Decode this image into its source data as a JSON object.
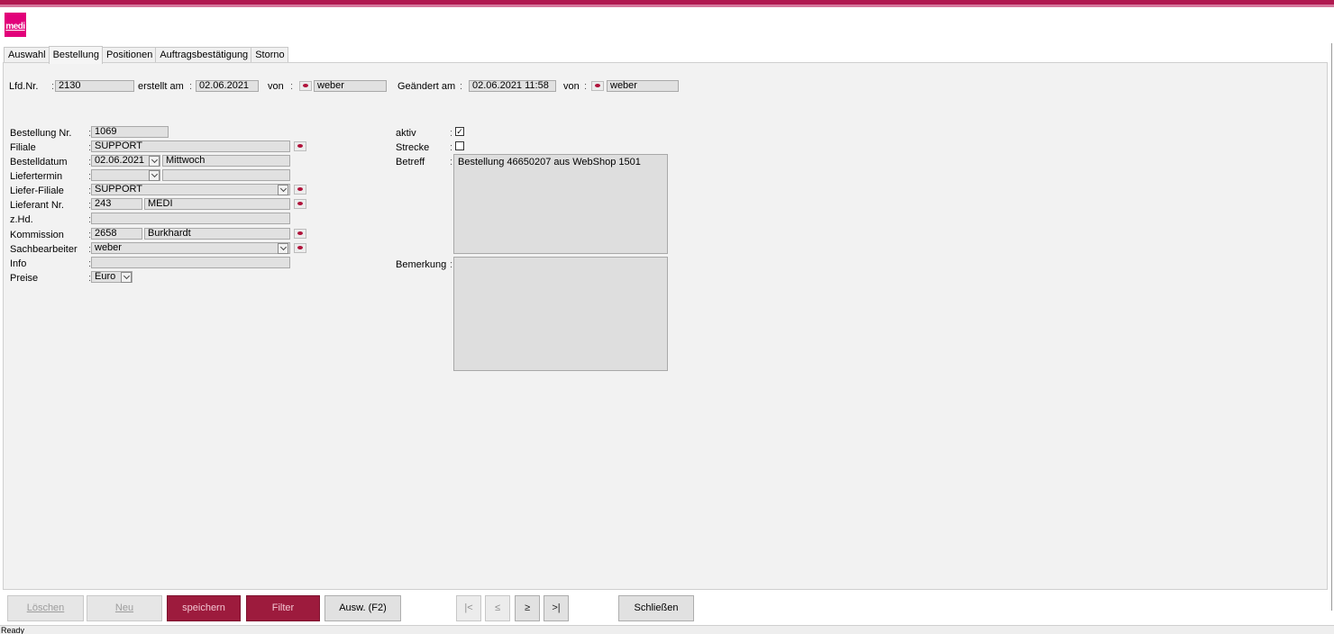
{
  "app": {
    "logo_text": "medi",
    "brand_color": "#e2007a",
    "accent_color": "#9d1b3d"
  },
  "tabs": [
    {
      "label": "Auswahl"
    },
    {
      "label": "Bestellung",
      "active": true
    },
    {
      "label": "Positionen"
    },
    {
      "label": "Auftragsbestätigung"
    },
    {
      "label": "Storno"
    }
  ],
  "header": {
    "lfdnr_label": "Lfd.Nr.",
    "lfdnr_value": "2130",
    "erstellt_label": "erstellt am",
    "erstellt_value": "02.06.2021",
    "von1_label": "von",
    "von1_value": "weber",
    "geaendert_label": "Geändert am",
    "geaendert_value": "02.06.2021 11:58",
    "von2_label": "von",
    "von2_value": "weber"
  },
  "form": {
    "bestellung_nr_label": "Bestellung Nr.",
    "bestellung_nr_value": "1069",
    "filiale_label": "Filiale",
    "filiale_value": "SUPPORT",
    "bestelldatum_label": "Bestelldatum",
    "bestelldatum_value": "02.06.2021",
    "bestelldatum_day": "Mittwoch",
    "liefertermin_label": "Liefertermin",
    "liefertermin_value": "",
    "liefertermin_day": "",
    "liefer_filiale_label": "Liefer-Filiale",
    "liefer_filiale_value": "SUPPORT",
    "lieferant_label": "Lieferant Nr.",
    "lieferant_nr": "243",
    "lieferant_name": "MEDI",
    "zhd_label": "z.Hd.",
    "zhd_value": "",
    "kommission_label": "Kommission",
    "kommission_nr": "2658",
    "kommission_name": "Burkhardt",
    "sachbearbeiter_label": "Sachbearbeiter",
    "sachbearbeiter_value": "weber",
    "info_label": "Info",
    "info_value": "",
    "preise_label": "Preise",
    "preise_value": "Euro",
    "aktiv_label": "aktiv",
    "aktiv_checked": true,
    "strecke_label": "Strecke",
    "strecke_checked": false,
    "betreff_label": "Betreff",
    "betreff_value": "Bestellung 46650207 aus WebShop 1501",
    "bemerkung_label": "Bemerkung",
    "bemerkung_value": ""
  },
  "buttons": {
    "loeschen": "Löschen",
    "neu": "Neu",
    "speichern": "speichern",
    "filter": "Filter",
    "ausw": "Ausw. (F2)",
    "first": "|<",
    "prev": "≤",
    "next": "≥",
    "last": ">|",
    "schliessen": "Schließen"
  },
  "status": {
    "text": "Ready"
  }
}
